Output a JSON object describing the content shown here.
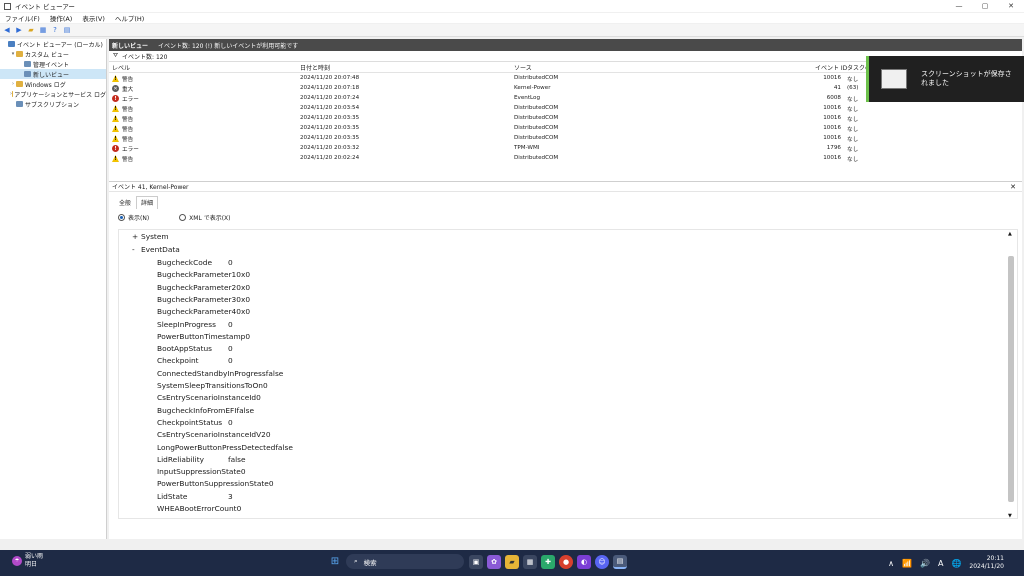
{
  "window": {
    "title": "イベント ビューアー",
    "controls": [
      "—",
      "▢",
      "✕"
    ]
  },
  "menu": [
    "ファイル(F)",
    "操作(A)",
    "表示(V)",
    "ヘルプ(H)"
  ],
  "tree": [
    {
      "label": "イベント ビューアー (ローカル)",
      "depth": 0,
      "arrow": "",
      "color": "#4a7fc1"
    },
    {
      "label": "カスタム ビュー",
      "depth": 1,
      "arrow": "▾",
      "color": "#e0b040"
    },
    {
      "label": "管理イベント",
      "depth": 2,
      "arrow": "",
      "color": "#6a8fb8"
    },
    {
      "label": "新しいビュー",
      "depth": 2,
      "arrow": "",
      "color": "#6a8fb8",
      "selected": true
    },
    {
      "label": "Windows ログ",
      "depth": 1,
      "arrow": "›",
      "color": "#e0b040"
    },
    {
      "label": "アプリケーションとサービス ログ",
      "depth": 1,
      "arrow": "›",
      "color": "#e0b040"
    },
    {
      "label": "サブスクリプション",
      "depth": 1,
      "arrow": "",
      "color": "#6a8fb8"
    }
  ],
  "header": {
    "view_name": "新しいビュー",
    "summary": "イベント数: 120 (!) 新しいイベントが利用可能です"
  },
  "filter": {
    "label": "イベント数: 120"
  },
  "columns": [
    "レベル",
    "日付と時刻",
    "ソース",
    "イベント ID",
    "タスクのカテゴリ"
  ],
  "events": [
    {
      "level": "警告",
      "kind": "warn",
      "glyph": "!",
      "datetime": "2024/11/20 20:07:48",
      "source": "DistributedCOM",
      "id": "10016",
      "category": "なし"
    },
    {
      "level": "重大",
      "kind": "crit",
      "glyph": "✕",
      "datetime": "2024/11/20 20:07:18",
      "source": "Kernel-Power",
      "id": "41",
      "category": "(63)"
    },
    {
      "level": "エラー",
      "kind": "err",
      "glyph": "!",
      "datetime": "2024/11/20 20:07:24",
      "source": "EventLog",
      "id": "6008",
      "category": "なし"
    },
    {
      "level": "警告",
      "kind": "warn",
      "glyph": "!",
      "datetime": "2024/11/20 20:03:54",
      "source": "DistributedCOM",
      "id": "10016",
      "category": "なし"
    },
    {
      "level": "警告",
      "kind": "warn",
      "glyph": "!",
      "datetime": "2024/11/20 20:03:35",
      "source": "DistributedCOM",
      "id": "10016",
      "category": "なし"
    },
    {
      "level": "警告",
      "kind": "warn",
      "glyph": "!",
      "datetime": "2024/11/20 20:03:35",
      "source": "DistributedCOM",
      "id": "10016",
      "category": "なし"
    },
    {
      "level": "警告",
      "kind": "warn",
      "glyph": "!",
      "datetime": "2024/11/20 20:03:35",
      "source": "DistributedCOM",
      "id": "10016",
      "category": "なし"
    },
    {
      "level": "エラー",
      "kind": "err",
      "glyph": "!",
      "datetime": "2024/11/20 20:03:32",
      "source": "TPM-WMI",
      "id": "1796",
      "category": "なし"
    },
    {
      "level": "警告",
      "kind": "warn",
      "glyph": "!",
      "datetime": "2024/11/20 20:02:24",
      "source": "DistributedCOM",
      "id": "10016",
      "category": "なし"
    }
  ],
  "detail": {
    "title": "イベント 41, Kernel-Power",
    "close": "✕",
    "tabs": [
      "全般",
      "詳細"
    ],
    "radio_friendly": "表示(N)",
    "radio_xml": "XML で表示(X)",
    "system_toggle": "+",
    "system_label": "System",
    "eventdata_toggle": "-",
    "eventdata_label": "EventData",
    "fields": [
      {
        "key": "BugcheckCode",
        "value": "0"
      },
      {
        "key": "BugcheckParameter1",
        "value": "0x0"
      },
      {
        "key": "BugcheckParameter2",
        "value": "0x0"
      },
      {
        "key": "BugcheckParameter3",
        "value": "0x0"
      },
      {
        "key": "BugcheckParameter4",
        "value": "0x0"
      },
      {
        "key": "SleepInProgress",
        "value": "0"
      },
      {
        "key": "PowerButtonTimestamp",
        "value": "0"
      },
      {
        "key": "BootAppStatus",
        "value": "0"
      },
      {
        "key": "Checkpoint",
        "value": "0"
      },
      {
        "key": "ConnectedStandbyInProgress",
        "value": "false"
      },
      {
        "key": "SystemSleepTransitionsToOn",
        "value": "0"
      },
      {
        "key": "CsEntryScenarioInstanceId",
        "value": "0"
      },
      {
        "key": "BugcheckInfoFromEFI",
        "value": "false"
      },
      {
        "key": "CheckpointStatus",
        "value": "0"
      },
      {
        "key": "CsEntryScenarioInstanceIdV2",
        "value": "0"
      },
      {
        "key": "LongPowerButtonPressDetected",
        "value": "false"
      },
      {
        "key": "LidReliability",
        "value": "false"
      },
      {
        "key": "InputSuppressionState",
        "value": "0"
      },
      {
        "key": "PowerButtonSuppressionState",
        "value": "0"
      },
      {
        "key": "LidState",
        "value": "3"
      },
      {
        "key": "WHEABootErrorCount",
        "value": "0"
      }
    ]
  },
  "toast": {
    "text": "スクリーンショットが保存されました"
  },
  "taskbar": {
    "weather_line1": "弱い雨",
    "weather_line2": "明日",
    "search_placeholder": "検索",
    "time": "20:11",
    "date": "2024/11/20",
    "tray_icons": [
      "∧",
      "📶",
      "🔊",
      "A",
      "🌐"
    ]
  },
  "colors": {
    "accent": "#2e6bd6",
    "header_bar": "#4a4a4a",
    "taskbar": "#1e2a45",
    "toast_accent": "#6cc04a"
  }
}
